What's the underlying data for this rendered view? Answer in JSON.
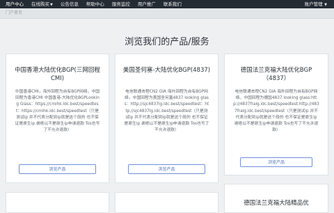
{
  "nav": {
    "items": [
      "用户中心",
      "在线购买",
      "公告信息",
      "帮助中心",
      "服务监控",
      "用户推广",
      "联系我们"
    ],
    "account": "账户管理"
  },
  "breadcrumb": "门户首页",
  "page_title": "浏览我们的产品/服务",
  "cards": [
    {
      "title": "中国香港大陆优化BGP(三网回程CMI)",
      "description": "中国香港CMI，海外回程为自有BGP网络，中国回程为香港CMI 中国香港-大陆优化BGPLooking Glass：https://cmihk.idc.best/speedtest：https://cmihk.idc.best/speedtest（只是测试ip 并不代表分配到ip就是这个段的 也不保证是原生ip 谢绝以不是原生ip申请退款 Tos也写了不允许退款）",
      "button": "浏览产品"
    },
    {
      "title": "美国圣何塞-大陆优化BGP(4837)",
      "description": "电信联通去程CN2 GIA 海外回程为自有BGP网络，中国回程为美国圣何塞4837 looking glass：http://sjc4837lg.idc.best/speedtest：http://sjc4837lg.idc.best/speedtest（只是测试ip 并不代表分配到ip就是这个段的 也不保证是原生ip 谢绝以不是原生ip申请退款 Tos也写了不允许退款）",
      "button": "浏览产品"
    },
    {
      "title": "德国法兰克福大陆优化BGP（4837）",
      "description": "电信联通去程CN2 GIA 海外回程为自有BGP网络，中国回程为德国4837 looking glass:http://4837fralg.idc.best/speedtest:http://4837fralg.idc.best/speedtest（只是测试ip 并不代表分配到ip就是这个段的 也不保证是原生ip 谢绝以不是原生ip申请退款 Tos也写了不允许退款）",
      "button": "浏览产品"
    },
    {
      "title": "德国法兰克福大陆精品优"
    }
  ]
}
